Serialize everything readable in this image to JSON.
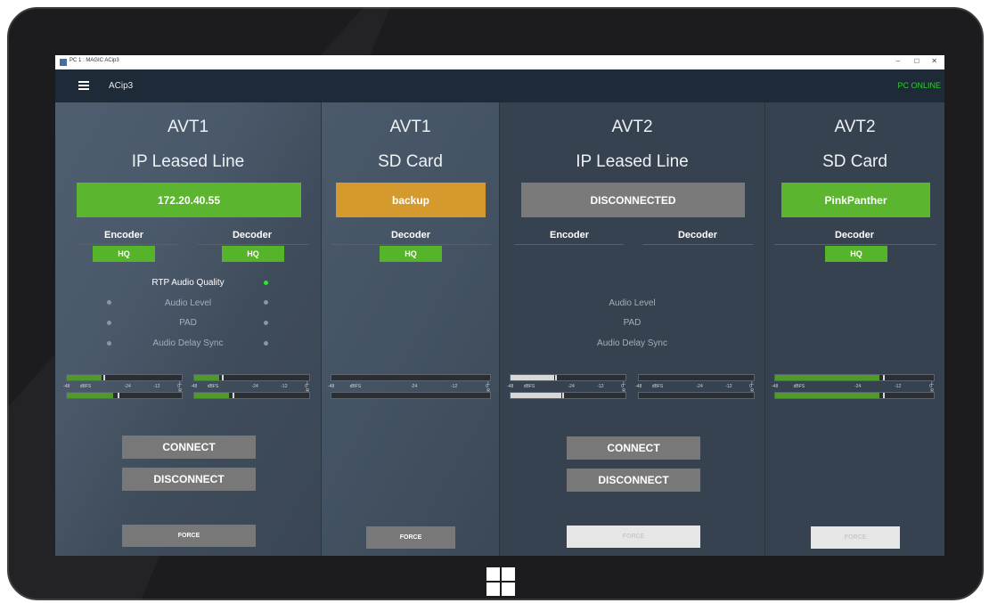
{
  "window": {
    "title": "PC 1 : MAGIC ACip3",
    "minimize": "–",
    "maximize": "☐",
    "close": "✕"
  },
  "app": {
    "name": "ACip3",
    "status": "PC ONLINE",
    "status_color": "#2ecc2e",
    "menu_icon": "hamburger-icon"
  },
  "colors": {
    "connected": "#5cb52f",
    "backup": "#d49a2e",
    "disconnected": "#7a7a7a",
    "hq": "#56b42b"
  },
  "columns": [
    {
      "codec": "AVT1",
      "connection": "IP Leased Line",
      "status": "172.20.40.55",
      "encoder_label": "Encoder",
      "decoder_label": "Decoder",
      "encoder_mode": "HQ",
      "decoder_mode": "HQ",
      "indicators": [
        {
          "label": "RTP Audio Quality",
          "active": true
        },
        {
          "label": "Audio Level",
          "active": false
        },
        {
          "label": "PAD",
          "active": false
        },
        {
          "label": "Audio Delay Sync",
          "active": false
        }
      ],
      "connect": "CONNECT",
      "disconnect": "DISCONNECT",
      "force": "FORCE"
    },
    {
      "codec": "AVT1",
      "connection": "SD Card",
      "status": "backup",
      "decoder_label": "Decoder",
      "decoder_mode": "HQ",
      "force": "FORCE"
    },
    {
      "codec": "AVT2",
      "connection": "IP Leased Line",
      "status": "DISCONNECTED",
      "encoder_label": "Encoder",
      "decoder_label": "Decoder",
      "indicators": [
        {
          "label": "Audio Level"
        },
        {
          "label": "PAD"
        },
        {
          "label": "Audio Delay Sync"
        }
      ],
      "connect": "CONNECT",
      "disconnect": "DISCONNECT",
      "force": "FORCE"
    },
    {
      "codec": "AVT2",
      "connection": "SD Card",
      "status": "PinkPanther",
      "decoder_label": "Decoder",
      "decoder_mode": "HQ",
      "force": "FORCE"
    }
  ],
  "meter_scale": {
    "ticks": [
      "-48",
      "dBFS",
      "-24",
      "-12",
      "0"
    ],
    "left": "L",
    "right": "R"
  },
  "meters": {
    "col1_enc": {
      "left_level": 0.3,
      "right_level": 0.4,
      "left_peak": 0.32,
      "right_peak": 0.44,
      "color": "#4f9a2a"
    },
    "col1_dec": {
      "left_level": 0.22,
      "right_level": 0.3,
      "left_peak": 0.24,
      "right_peak": 0.33,
      "color": "#4f9a2a"
    },
    "col2_dec": {
      "left_level": 0,
      "right_level": 0,
      "left_peak": 0,
      "right_peak": 0,
      "color": "#4f9a2a"
    },
    "col3_enc": {
      "left_level": 0.38,
      "right_level": 0.44,
      "left_peak": 0.39,
      "right_peak": 0.45,
      "color": "#d8d8d8"
    },
    "col3_dec": {
      "left_level": 0,
      "right_level": 0,
      "left_peak": 0,
      "right_peak": 0,
      "color": "#4f9a2a"
    },
    "col4_dec": {
      "left_level": 0.66,
      "right_level": 0.66,
      "left_peak": 0.68,
      "right_peak": 0.68,
      "color": "#4f9a2a"
    }
  }
}
